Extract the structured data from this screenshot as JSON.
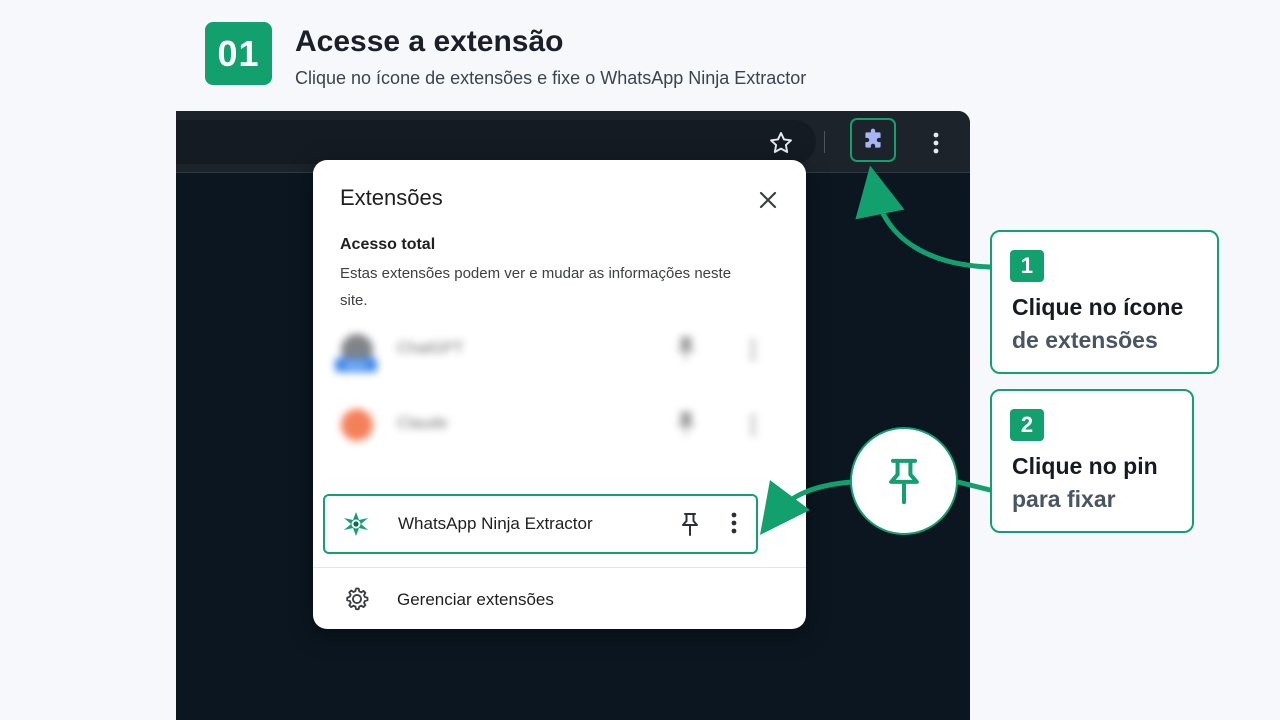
{
  "header": {
    "step_number": "01",
    "title": "Acesse a extensão",
    "subtitle": "Clique no ícone de extensões e fixe o WhatsApp Ninja Extractor"
  },
  "browser": {
    "toolbar": {
      "bookmark_icon": "star-icon",
      "extensions_icon": "puzzle-icon",
      "menu_icon": "kebab-menu-icon"
    }
  },
  "popup": {
    "title": "Extensões",
    "close_icon": "close-icon",
    "section_title": "Acesso total",
    "section_desc": "Estas extensões podem ver e mudar as informações neste site.",
    "blurred_items": [
      {
        "name": "ChatGPT",
        "badge": "NEW"
      },
      {
        "name": "Claude"
      }
    ],
    "highlighted_item": {
      "name": "WhatsApp Ninja Extractor",
      "pin_icon": "pin-icon",
      "menu_icon": "kebab-menu-icon"
    },
    "manage_label": "Gerenciar extensões",
    "manage_icon": "gear-icon"
  },
  "callouts": [
    {
      "number": "1",
      "line1": "Clique no ícone",
      "line2": "de extensões"
    },
    {
      "number": "2",
      "line1": "Clique no pin",
      "line2": "para fixar"
    }
  ],
  "colors": {
    "accent": "#13a06f",
    "page_bg": "#f6f8fb",
    "browser_bg": "#0b1620",
    "toolbar_bg": "#1c232b"
  }
}
